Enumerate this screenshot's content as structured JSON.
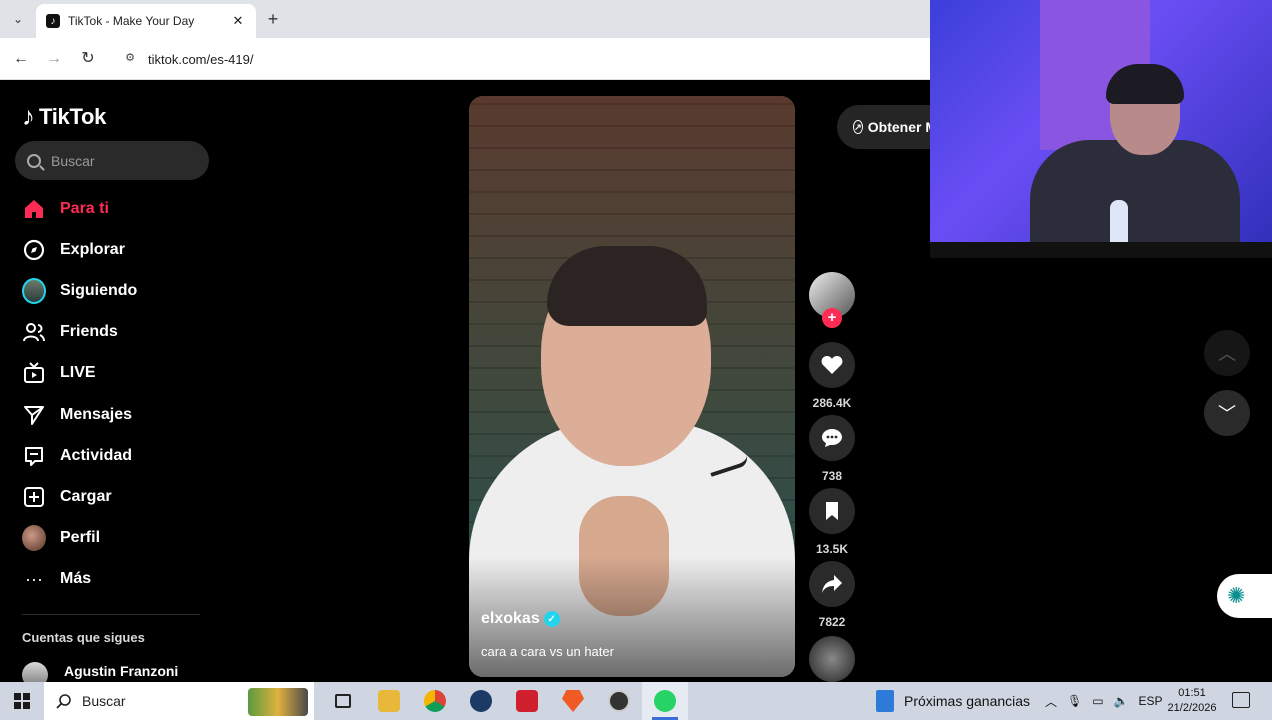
{
  "browser": {
    "tab_title": "TikTok - Make Your Day",
    "tab_icon": "tiktok-favicon",
    "url": "tiktok.com/es-419/"
  },
  "sidebar": {
    "logo_text": "TikTok",
    "search_placeholder": "Buscar",
    "items": [
      {
        "label": "Para ti",
        "icon": "home-icon",
        "active": true
      },
      {
        "label": "Explorar",
        "icon": "compass-icon"
      },
      {
        "label": "Siguiendo",
        "icon": "following-avatar"
      },
      {
        "label": "Friends",
        "icon": "friends-icon"
      },
      {
        "label": "LIVE",
        "icon": "live-tv-icon"
      },
      {
        "label": "Mensajes",
        "icon": "send-icon"
      },
      {
        "label": "Actividad",
        "icon": "activity-icon"
      },
      {
        "label": "Cargar",
        "icon": "upload-plus-icon"
      },
      {
        "label": "Perfil",
        "icon": "profile-avatar"
      },
      {
        "label": "Más",
        "icon": "more-dots-icon"
      }
    ],
    "following_title": "Cuentas que sigues",
    "following": [
      {
        "name": "Agustin Franzoni"
      }
    ]
  },
  "video": {
    "author": "elxokas",
    "caption": "cara a cara vs un hater"
  },
  "actions": {
    "likes": "286.4K",
    "comments": "738",
    "saves": "13.5K",
    "shares": "7822"
  },
  "get_app_label": "Obtener M",
  "taskbar": {
    "search_label": "Buscar",
    "widget_label": "Próximas ganancias",
    "lang": "ESP",
    "time": "01:51",
    "date": "21/2/2026"
  },
  "colors": {
    "accent": "#fe2c55",
    "verified": "#20d5ec"
  }
}
